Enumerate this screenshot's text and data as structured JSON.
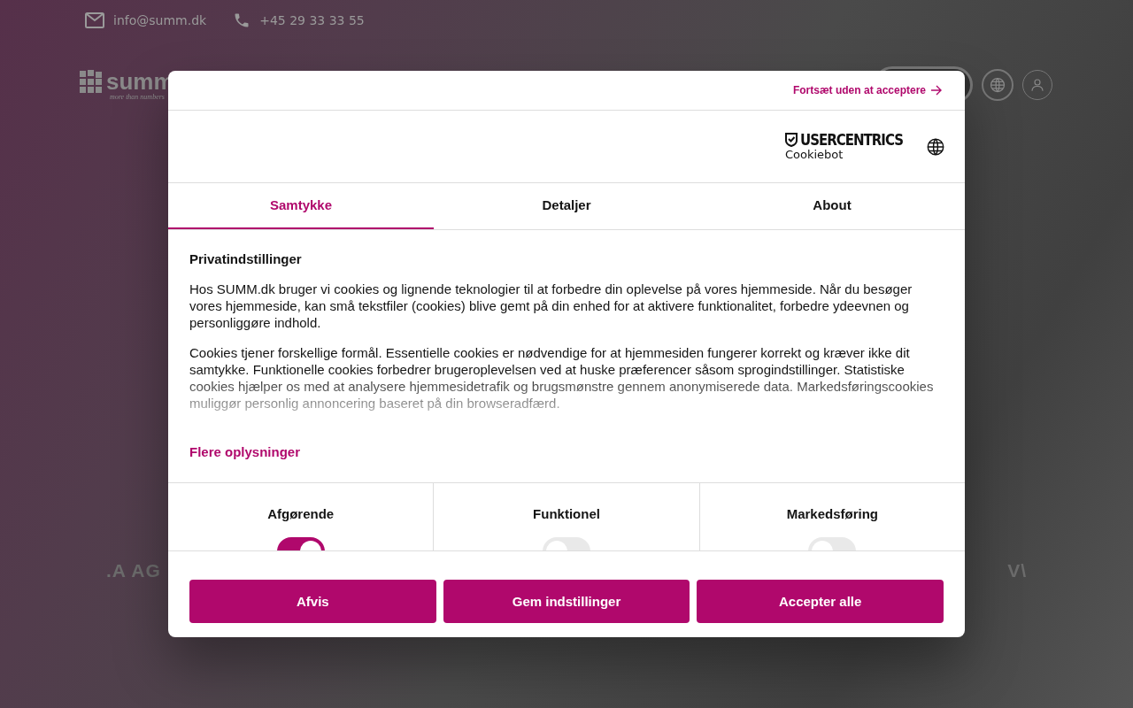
{
  "page": {
    "contact": [
      {
        "kind": "email",
        "text": "info@summ.dk"
      },
      {
        "kind": "phone",
        "text": "+45 29 33 33 55"
      }
    ],
    "logo": {
      "wordmark": "summ",
      "tagline": "more than numbers"
    },
    "background_fragments": [
      ".A AG",
      "V\\"
    ]
  },
  "dialog": {
    "skip_link": "Fortsæt uden at acceptere",
    "brand": {
      "name": "USERCENTRICS",
      "product": "Cookiebot"
    },
    "tabs": [
      {
        "label": "Samtykke",
        "selected": true
      },
      {
        "label": "Detaljer",
        "selected": false
      },
      {
        "label": "About",
        "selected": false
      }
    ],
    "heading": "Privatindstillinger",
    "paragraphs": [
      "Hos SUMM.dk bruger vi cookies og lignende teknologier til at forbedre din oplevelse på vores hjemmeside. Når du besøger vores hjemmeside, kan små tekstfiler (cookies) blive gemt på din enhed for at aktivere funktionalitet, forbedre ydeevnen og personliggøre indhold.",
      "Cookies tjener forskellige formål. Essentielle cookies er nødvendige for at hjemmesiden fungerer korrekt og kræver ikke dit samtykke. Funktionelle cookies forbedrer brugeroplevelsen ved at huske præferencer såsom sprogindstillinger. Statistiske cookies hjælper os med at analysere hjemmesidetrafik og brugsmønstre gennem anonymiserede data. Markedsføringscookies muliggør personlig annoncering baseret på din browseradfærd."
    ],
    "more_link": "Flere oplysninger",
    "categories": [
      {
        "label": "Afgørende",
        "on": true
      },
      {
        "label": "Funktionel",
        "on": false
      },
      {
        "label": "Markedsføring",
        "on": false
      }
    ],
    "buttons": [
      "Afvis",
      "Gem indstillinger",
      "Accepter alle"
    ]
  }
}
